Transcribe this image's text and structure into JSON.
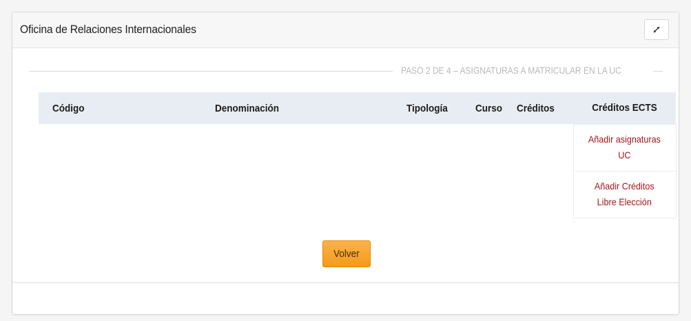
{
  "panel": {
    "title": "Oficina de Relaciones Internacionales",
    "expand_icon": "expand-icon"
  },
  "step": {
    "text": "PASO 2 DE 4 – ASIGNATURAS A MATRICULAR EN LA UC"
  },
  "table": {
    "headers": {
      "codigo": "Código",
      "denominacion": "Denominación",
      "tipologia": "Tipología",
      "curso": "Curso",
      "creditos": "Créditos",
      "creditos_ects": "Créditos ECTS"
    },
    "actions": [
      {
        "line1": "Añadir asignaturas",
        "line2": "UC"
      },
      {
        "line1": "Añadir Créditos",
        "line2": "Libre Elección"
      }
    ]
  },
  "buttons": {
    "volver": "Volver"
  },
  "colors": {
    "header_bg": "#e8edf3",
    "link": "#a4161a",
    "button_orange": "#f7a32c"
  }
}
